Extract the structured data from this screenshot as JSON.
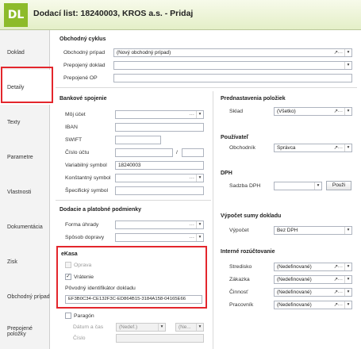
{
  "header": {
    "logo": "DL",
    "title": "Dodací list: 18240003, KROS a.s. - Pridaj"
  },
  "sidebar": {
    "items": [
      {
        "label": "Doklad"
      },
      {
        "label": "Detaily"
      },
      {
        "label": "Texty"
      },
      {
        "label": "Parametre"
      },
      {
        "label": "Vlastnosti"
      },
      {
        "label": "Dokumentácia"
      },
      {
        "label": "Zisk"
      },
      {
        "label": "Obchodný prípad"
      },
      {
        "label": "Prepojené položky"
      }
    ],
    "active": "Detaily"
  },
  "obchodny_cyklus": {
    "title": "Obchodný cyklus",
    "obchodny_pripad_label": "Obchodný prípad",
    "obchodny_pripad_value": "(Nový obchodný prípad)",
    "prepojeny_doklad_label": "Prepojený doklad",
    "prepojene_op_label": "Prepojené OP"
  },
  "bankove_spojenie": {
    "title": "Bankové spojenie",
    "moj_ucet_label": "Môj účet",
    "iban_label": "IBAN",
    "swift_label": "SWIFT",
    "cislo_uctu_label": "Číslo účtu",
    "cislo_uctu_slash": "/",
    "variabilny_symbol_label": "Variabilný symbol",
    "variabilny_symbol_value": "18240003",
    "konstantny_symbol_label": "Konštantný symbol",
    "specificky_symbol_label": "Špecifický symbol"
  },
  "dodacie": {
    "title": "Dodacie a platobné podmienky",
    "forma_uhrady_label": "Forma úhrady",
    "sposob_dopravy_label": "Spôsob dopravy"
  },
  "ekasa": {
    "title": "eKasa",
    "oprava_label": "Oprava",
    "oprava_checked": false,
    "vratenie_label": "Vrátenie",
    "vratenie_checked": true,
    "identifikator_label": "Pôvodný identifikátor dokladu",
    "identifikator_value": "EF3B0C34-CE132F3C-ED864B15-3184A158-04165E66",
    "paragon_label": "Paragón",
    "paragon_checked": false,
    "datum_label": "Dátum a čas",
    "datum_value": "(Nedef.)",
    "cas_value": "(Ne...",
    "cislo_label": "Číslo"
  },
  "prednastavenia": {
    "title": "Prednastavenia položiek",
    "sklad_label": "Sklad",
    "sklad_value": "(Všetko)"
  },
  "pouzivatel": {
    "title": "Používateľ",
    "obchodnik_label": "Obchodník",
    "obchodnik_value": "Správca"
  },
  "dph": {
    "title": "DPH",
    "sadzba_label": "Sadzba DPH",
    "pouzi_label": "Použi"
  },
  "vypocet_sumy": {
    "title": "Výpočet sumy dokladu",
    "vypocet_label": "Výpočet",
    "vypocet_value": "Bez DPH"
  },
  "interne": {
    "title": "Interné rozúčtovanie",
    "stredisko_label": "Stredisko",
    "stredisko_value": "(Nedefinované)",
    "zakazka_label": "Zákazka",
    "zakazka_value": "(Nedefinované)",
    "cinnost_label": "Činnosť",
    "cinnost_value": "(Nedefinované)",
    "pracovnik_label": "Pracovník",
    "pracovnik_value": "(Nedefinované)"
  },
  "icons": {
    "ellipsis": "···",
    "link": "↗",
    "dropdown": "▾"
  }
}
